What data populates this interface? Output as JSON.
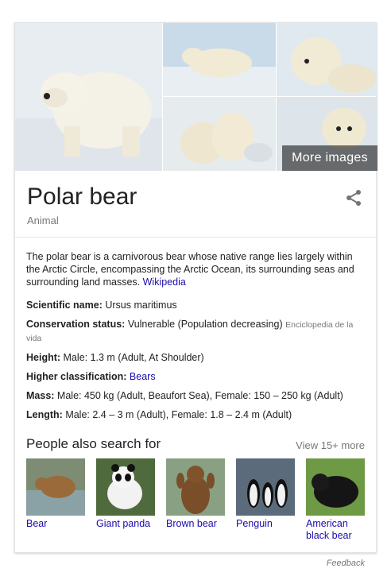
{
  "gallery": {
    "more_images_label": "More images"
  },
  "header": {
    "title": "Polar bear",
    "subtitle": "Animal"
  },
  "description": {
    "text": "The polar bear is a carnivorous bear whose native range lies largely within the Arctic Circle, encompassing the Arctic Ocean, its surrounding seas and surrounding land masses.",
    "source_link": "Wikipedia"
  },
  "facts": [
    {
      "label": "Scientific name:",
      "value": "Ursus maritimus"
    },
    {
      "label": "Conservation status:",
      "value": "Vulnerable (Population decreasing)",
      "source": "Enciclopedia de la vida"
    },
    {
      "label": "Height:",
      "value": "Male: 1.3 m (Adult, At Shoulder)"
    },
    {
      "label": "Higher classification:",
      "link": "Bears"
    },
    {
      "label": "Mass:",
      "value": "Male: 450 kg (Adult, Beaufort Sea), Female: 150 – 250 kg (Adult)"
    },
    {
      "label": "Length:",
      "value": "Male: 2.4 – 3 m (Adult), Female: 1.8 – 2.4 m (Adult)"
    }
  ],
  "people_also_search": {
    "heading": "People also search for",
    "view_more": "View 15+ more",
    "items": [
      {
        "label": "Bear"
      },
      {
        "label": "Giant panda"
      },
      {
        "label": "Brown bear"
      },
      {
        "label": "Penguin"
      },
      {
        "label": "American black bear"
      }
    ]
  },
  "footer": {
    "feedback": "Feedback"
  }
}
